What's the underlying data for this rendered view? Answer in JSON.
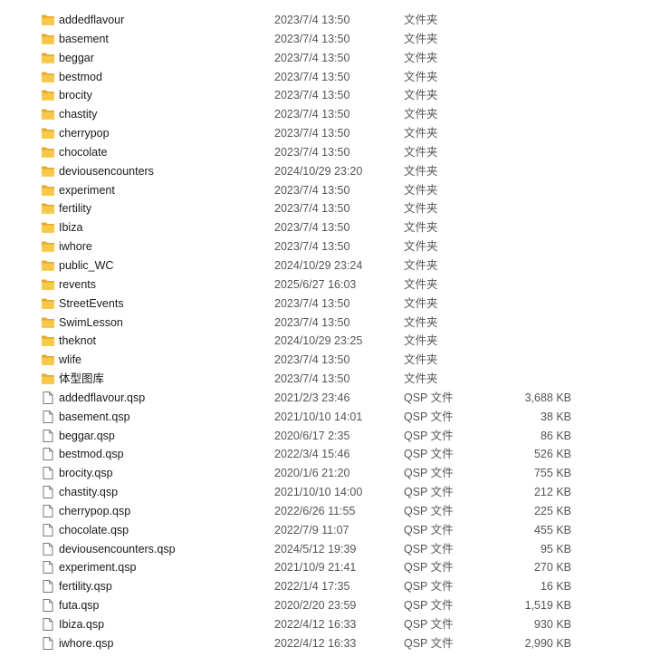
{
  "rows": [
    {
      "kind": "folder",
      "icon": "folder-icon",
      "name": "addedflavour",
      "date": "2023/7/4 13:50",
      "type": "文件夹",
      "size": ""
    },
    {
      "kind": "folder",
      "icon": "folder-icon",
      "name": "basement",
      "date": "2023/7/4 13:50",
      "type": "文件夹",
      "size": ""
    },
    {
      "kind": "folder",
      "icon": "folder-icon",
      "name": "beggar",
      "date": "2023/7/4 13:50",
      "type": "文件夹",
      "size": ""
    },
    {
      "kind": "folder",
      "icon": "folder-icon",
      "name": "bestmod",
      "date": "2023/7/4 13:50",
      "type": "文件夹",
      "size": ""
    },
    {
      "kind": "folder",
      "icon": "folder-icon",
      "name": "brocity",
      "date": "2023/7/4 13:50",
      "type": "文件夹",
      "size": ""
    },
    {
      "kind": "folder",
      "icon": "folder-icon",
      "name": "chastity",
      "date": "2023/7/4 13:50",
      "type": "文件夹",
      "size": ""
    },
    {
      "kind": "folder",
      "icon": "folder-icon",
      "name": "cherrypop",
      "date": "2023/7/4 13:50",
      "type": "文件夹",
      "size": ""
    },
    {
      "kind": "folder",
      "icon": "folder-icon",
      "name": "chocolate",
      "date": "2023/7/4 13:50",
      "type": "文件夹",
      "size": ""
    },
    {
      "kind": "folder",
      "icon": "folder-icon",
      "name": "deviousencounters",
      "date": "2024/10/29 23:20",
      "type": "文件夹",
      "size": ""
    },
    {
      "kind": "folder",
      "icon": "folder-icon",
      "name": "experiment",
      "date": "2023/7/4 13:50",
      "type": "文件夹",
      "size": ""
    },
    {
      "kind": "folder",
      "icon": "folder-icon",
      "name": "fertility",
      "date": "2023/7/4 13:50",
      "type": "文件夹",
      "size": ""
    },
    {
      "kind": "folder",
      "icon": "folder-icon",
      "name": "Ibiza",
      "date": "2023/7/4 13:50",
      "type": "文件夹",
      "size": ""
    },
    {
      "kind": "folder",
      "icon": "folder-icon",
      "name": "iwhore",
      "date": "2023/7/4 13:50",
      "type": "文件夹",
      "size": ""
    },
    {
      "kind": "folder",
      "icon": "folder-icon",
      "name": "public_WC",
      "date": "2024/10/29 23:24",
      "type": "文件夹",
      "size": ""
    },
    {
      "kind": "folder",
      "icon": "folder-icon",
      "name": "revents",
      "date": "2025/6/27 16:03",
      "type": "文件夹",
      "size": ""
    },
    {
      "kind": "folder",
      "icon": "folder-icon",
      "name": "StreetEvents",
      "date": "2023/7/4 13:50",
      "type": "文件夹",
      "size": ""
    },
    {
      "kind": "folder",
      "icon": "folder-icon",
      "name": "SwimLesson",
      "date": "2023/7/4 13:50",
      "type": "文件夹",
      "size": ""
    },
    {
      "kind": "folder",
      "icon": "folder-icon",
      "name": "theknot",
      "date": "2024/10/29 23:25",
      "type": "文件夹",
      "size": ""
    },
    {
      "kind": "folder",
      "icon": "folder-icon",
      "name": "wlife",
      "date": "2023/7/4 13:50",
      "type": "文件夹",
      "size": ""
    },
    {
      "kind": "folder",
      "icon": "folder-icon",
      "name": "体型图库",
      "date": "2023/7/4 13:50",
      "type": "文件夹",
      "size": ""
    },
    {
      "kind": "file",
      "icon": "file-icon",
      "name": "addedflavour.qsp",
      "date": "2021/2/3 23:46",
      "type": "QSP 文件",
      "size": "3,688 KB"
    },
    {
      "kind": "file",
      "icon": "file-icon",
      "name": "basement.qsp",
      "date": "2021/10/10 14:01",
      "type": "QSP 文件",
      "size": "38 KB"
    },
    {
      "kind": "file",
      "icon": "file-icon",
      "name": "beggar.qsp",
      "date": "2020/6/17 2:35",
      "type": "QSP 文件",
      "size": "86 KB"
    },
    {
      "kind": "file",
      "icon": "file-icon",
      "name": "bestmod.qsp",
      "date": "2022/3/4 15:46",
      "type": "QSP 文件",
      "size": "526 KB"
    },
    {
      "kind": "file",
      "icon": "file-icon",
      "name": "brocity.qsp",
      "date": "2020/1/6 21:20",
      "type": "QSP 文件",
      "size": "755 KB"
    },
    {
      "kind": "file",
      "icon": "file-icon",
      "name": "chastity.qsp",
      "date": "2021/10/10 14:00",
      "type": "QSP 文件",
      "size": "212 KB"
    },
    {
      "kind": "file",
      "icon": "file-icon",
      "name": "cherrypop.qsp",
      "date": "2022/6/26 11:55",
      "type": "QSP 文件",
      "size": "225 KB"
    },
    {
      "kind": "file",
      "icon": "file-icon",
      "name": "chocolate.qsp",
      "date": "2022/7/9 11:07",
      "type": "QSP 文件",
      "size": "455 KB"
    },
    {
      "kind": "file",
      "icon": "file-icon",
      "name": "deviousencounters.qsp",
      "date": "2024/5/12 19:39",
      "type": "QSP 文件",
      "size": "95 KB"
    },
    {
      "kind": "file",
      "icon": "file-icon",
      "name": "experiment.qsp",
      "date": "2021/10/9 21:41",
      "type": "QSP 文件",
      "size": "270 KB"
    },
    {
      "kind": "file",
      "icon": "file-icon",
      "name": "fertility.qsp",
      "date": "2022/1/4 17:35",
      "type": "QSP 文件",
      "size": "16 KB"
    },
    {
      "kind": "file",
      "icon": "file-icon",
      "name": "futa.qsp",
      "date": "2020/2/20 23:59",
      "type": "QSP 文件",
      "size": "1,519 KB"
    },
    {
      "kind": "file",
      "icon": "file-icon",
      "name": "Ibiza.qsp",
      "date": "2022/4/12 16:33",
      "type": "QSP 文件",
      "size": "930 KB"
    },
    {
      "kind": "file",
      "icon": "file-icon",
      "name": "iwhore.qsp",
      "date": "2022/4/12 16:33",
      "type": "QSP 文件",
      "size": "2,990 KB"
    }
  ],
  "colors": {
    "folder_back": "#e8a92b",
    "folder_front": "#f8c946",
    "file_stroke": "#7a7a7a",
    "secondary_text": "#555555"
  }
}
